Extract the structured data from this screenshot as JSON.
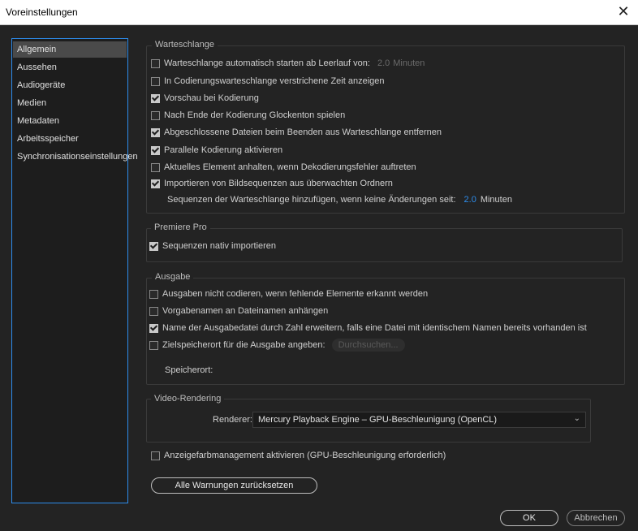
{
  "window": {
    "title": "Voreinstellungen"
  },
  "sidebar": {
    "items": [
      {
        "label": "Allgemein",
        "active": true
      },
      {
        "label": "Aussehen"
      },
      {
        "label": "Audiogeräte"
      },
      {
        "label": "Medien"
      },
      {
        "label": "Metadaten"
      },
      {
        "label": "Arbeitsspeicher"
      },
      {
        "label": "Synchronisationseinstellungen"
      }
    ]
  },
  "queue": {
    "legend": "Warteschlange",
    "opt1": {
      "label": "Warteschlange automatisch starten ab Leerlauf von:",
      "value": "2.0",
      "unit": "Minuten",
      "checked": false
    },
    "opt2": {
      "label": "In Codierungswarteschlange verstrichene Zeit anzeigen",
      "checked": false
    },
    "opt3": {
      "label": "Vorschau bei Kodierung",
      "checked": true
    },
    "opt4": {
      "label": "Nach Ende der Kodierung Glockenton spielen",
      "checked": false
    },
    "opt5": {
      "label": "Abgeschlossene Dateien beim Beenden aus Warteschlange entfernen",
      "checked": true
    },
    "opt6": {
      "label": "Parallele Kodierung aktivieren",
      "checked": true
    },
    "opt7": {
      "label": "Aktuelles Element anhalten, wenn Dekodierungsfehler auftreten",
      "checked": false
    },
    "opt8": {
      "label": "Importieren von Bildsequenzen aus überwachten Ordnern",
      "checked": true
    },
    "seq_label": "Sequenzen der Warteschlange hinzufügen, wenn keine Änderungen seit:",
    "seq_value": "2.0",
    "seq_unit": "Minuten"
  },
  "premiere": {
    "legend": "Premiere Pro",
    "opt1": {
      "label": "Sequenzen nativ importieren",
      "checked": true
    }
  },
  "output": {
    "legend": "Ausgabe",
    "opt1": {
      "label": "Ausgaben nicht codieren, wenn fehlende Elemente erkannt werden",
      "checked": false
    },
    "opt2": {
      "label": "Vorgabenamen an Dateinamen anhängen",
      "checked": false
    },
    "opt3": {
      "label": "Name der Ausgabedatei durch Zahl erweitern, falls eine Datei mit identischem Namen bereits vorhanden ist",
      "checked": true
    },
    "opt4": {
      "label": "Zielspeicherort für die Ausgabe angeben:",
      "checked": false
    },
    "browse_label": "Durchsuchen...",
    "location_label": "Speicherort:"
  },
  "video": {
    "legend": "Video-Rendering",
    "renderer_label": "Renderer:",
    "renderer_value": "Mercury Playback Engine – GPU-Beschleunigung (OpenCL)"
  },
  "display_color": {
    "label": "Anzeigefarbmanagement aktivieren (GPU-Beschleunigung erforderlich)",
    "checked": false
  },
  "reset_warnings_label": "Alle Warnungen zurücksetzen",
  "buttons": {
    "ok": "OK",
    "cancel": "Abbrechen"
  }
}
